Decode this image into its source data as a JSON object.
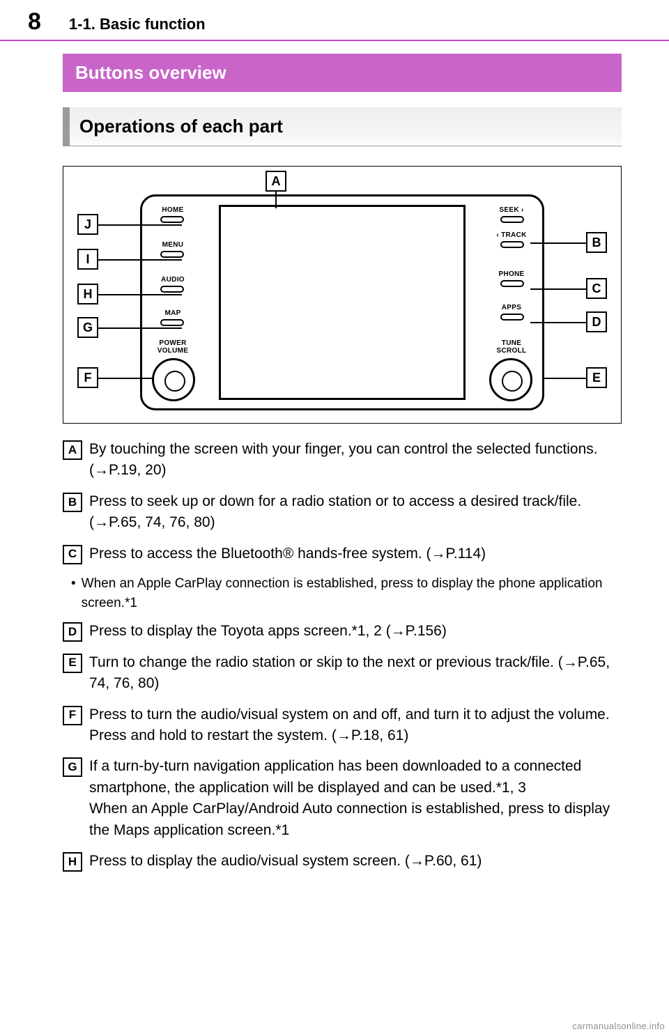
{
  "page_number": "8",
  "section_path": "1-1. Basic function",
  "box_title": "Buttons overview",
  "sub_title": "Operations of each part",
  "diagram": {
    "callouts": [
      "A",
      "B",
      "C",
      "D",
      "E",
      "F",
      "G",
      "H",
      "I",
      "J"
    ],
    "left_buttons": [
      "HOME",
      "MENU",
      "AUDIO",
      "MAP"
    ],
    "left_knob_label": "POWER\nVOLUME",
    "right_buttons": [
      "SEEK ›",
      "‹ TRACK",
      "PHONE",
      "APPS"
    ],
    "right_knob_label": "TUNE\nSCROLL"
  },
  "descriptions": [
    {
      "key": "A",
      "text": "By touching the screen with your finger, you can control the selected functions. (→P.19, 20)"
    },
    {
      "key": "B",
      "text": "Press to seek up or down for a radio station or to access a desired track/file. (→P.65, 74, 76, 80)"
    },
    {
      "key": "C",
      "text": "Press to access the Bluetooth® hands-free system. (→P.114)"
    }
  ],
  "bullet_after_C": "When an Apple CarPlay connection is established, press to display the phone application screen.*1",
  "descriptions2": [
    {
      "key": "D",
      "text": "Press to display the Toyota apps screen.*1, 2 (→P.156)"
    },
    {
      "key": "E",
      "text": "Turn to change the radio station or skip to the next or previous track/file. (→P.65, 74, 76, 80)"
    },
    {
      "key": "F",
      "text": "Press to turn the audio/visual system on and off, and turn it to adjust the volume. Press and hold to restart the system. (→P.18, 61)"
    },
    {
      "key": "G",
      "text": "If a turn-by-turn navigation application has been downloaded to a connected smartphone, the application will be displayed and can be used.*1, 3\nWhen an Apple CarPlay/Android Auto connection is established, press to display the Maps application screen.*1"
    },
    {
      "key": "H",
      "text": "Press to display the audio/visual system screen. (→P.60, 61)"
    }
  ],
  "watermark": "carmanualsonline.info"
}
